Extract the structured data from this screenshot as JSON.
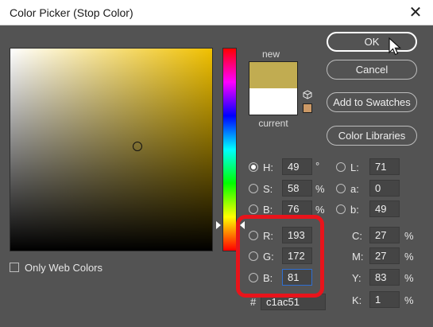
{
  "window": {
    "title": "Color Picker (Stop Color)",
    "close_glyph": "✕"
  },
  "swatch": {
    "new_label": "new",
    "current_label": "current",
    "new_color": "#c1ac51",
    "current_color": "#ffffff",
    "web_safe_color": "#cc9966"
  },
  "buttons": {
    "ok": "OK",
    "cancel": "Cancel",
    "add_to_swatches": "Add to Swatches",
    "color_libraries": "Color Libraries"
  },
  "fields": {
    "h": {
      "label": "H:",
      "value": "49",
      "unit": "°",
      "selected": true
    },
    "s": {
      "label": "S:",
      "value": "58",
      "unit": "%"
    },
    "b": {
      "label": "B:",
      "value": "76",
      "unit": "%"
    },
    "r": {
      "label": "R:",
      "value": "193"
    },
    "g": {
      "label": "G:",
      "value": "172"
    },
    "bl": {
      "label": "B:",
      "value": "81"
    },
    "l": {
      "label": "L:",
      "value": "71"
    },
    "a": {
      "label": "a:",
      "value": "0"
    },
    "lab_b": {
      "label": "b:",
      "value": "49"
    },
    "c": {
      "label": "C:",
      "value": "27",
      "unit": "%"
    },
    "m": {
      "label": "M:",
      "value": "27",
      "unit": "%"
    },
    "y": {
      "label": "Y:",
      "value": "83",
      "unit": "%"
    },
    "k": {
      "label": "K:",
      "value": "1",
      "unit": "%"
    }
  },
  "hex": {
    "label": "#",
    "value": "c1ac51"
  },
  "web_colors": {
    "label": "Only Web Colors",
    "checked": false
  },
  "icons": [
    "close-icon",
    "cursor-pointer-icon",
    "cube-icon",
    "hue-slider-arrow-icon"
  ],
  "annotation": {
    "color": "#e8141b"
  }
}
